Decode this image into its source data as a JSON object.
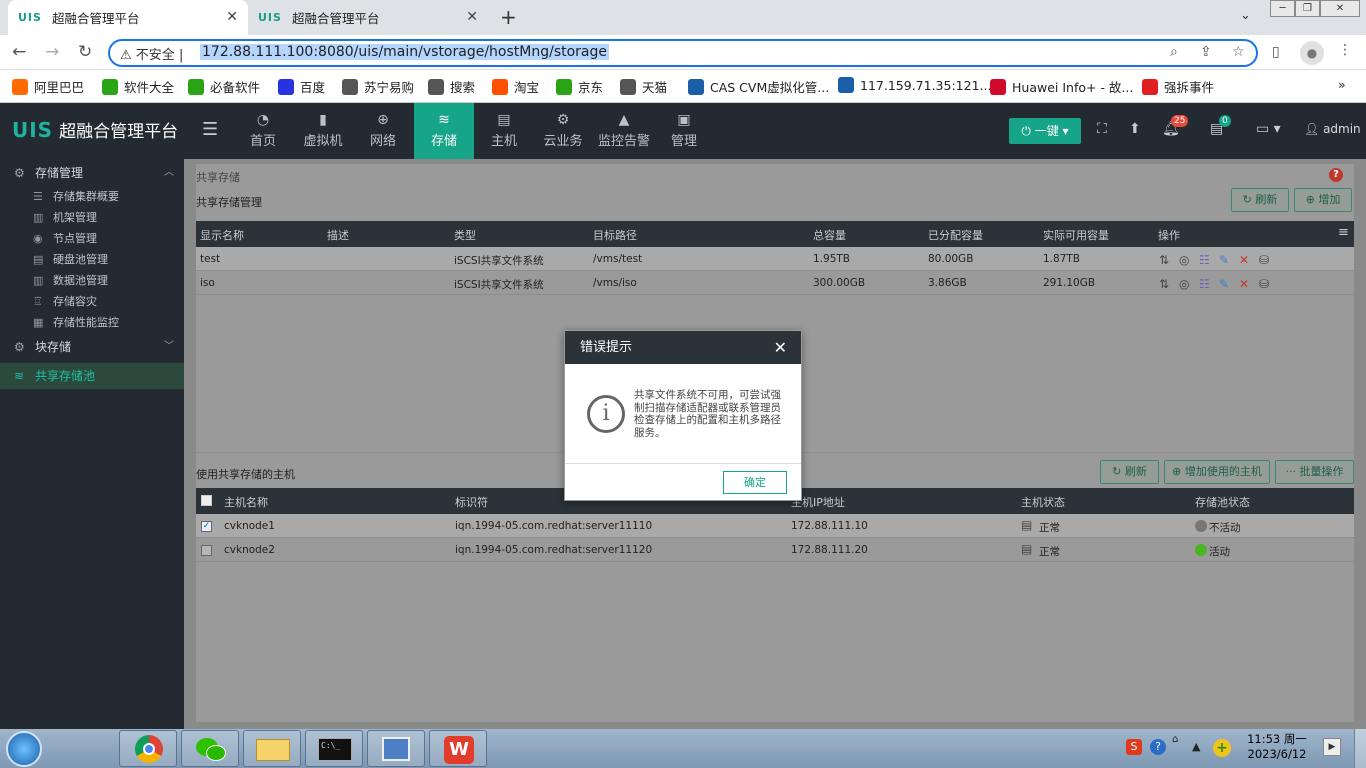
{
  "browser": {
    "tabs": [
      {
        "favicon": "UIS",
        "title": "超融合管理平台"
      },
      {
        "favicon": "UIS",
        "title": "超融合管理平台"
      }
    ],
    "security_label": "不安全",
    "url": "172.88.111.100:8080/uis/main/vstorage/hostMng/storage",
    "bookmarks": [
      {
        "label": "阿里巴巴",
        "color": "#ff6a00"
      },
      {
        "label": "软件大全",
        "color": "#2aa515"
      },
      {
        "label": "必备软件",
        "color": "#2aa515"
      },
      {
        "label": "百度",
        "color": "#2932e1"
      },
      {
        "label": "苏宁易购",
        "color": "#555555"
      },
      {
        "label": "搜索",
        "color": "#555555"
      },
      {
        "label": "淘宝",
        "color": "#ff5000"
      },
      {
        "label": "京东",
        "color": "#2aa515"
      },
      {
        "label": "天猫",
        "color": "#555555"
      },
      {
        "label": "CAS CVM虚拟化管...",
        "color": "#1a5fa8"
      },
      {
        "label": "117.159.71.35:121...",
        "color": "#1a5fa8"
      },
      {
        "label": "Huawei Info+ - 故...",
        "color": "#cf0a2c"
      },
      {
        "label": "强拆事件",
        "color": "#e02020"
      }
    ]
  },
  "app": {
    "logo_mark": "UIS",
    "logo_text": "超融合管理平台",
    "nav": [
      {
        "label": "首页",
        "icon": "dashboard-icon"
      },
      {
        "label": "虚拟机",
        "icon": "vm-icon"
      },
      {
        "label": "网络",
        "icon": "globe-icon"
      },
      {
        "label": "存储",
        "icon": "database-icon",
        "active": true
      },
      {
        "label": "主机",
        "icon": "server-icon"
      },
      {
        "label": "云业务",
        "icon": "gear-icon"
      },
      {
        "label": "监控告警",
        "icon": "bell-icon"
      },
      {
        "label": "管理",
        "icon": "monitor-icon"
      }
    ],
    "onekey_label": "一键",
    "alarm_count": "25",
    "task_count": "0",
    "user": "admin"
  },
  "sidebar": {
    "storage_mgmt": "存储管理",
    "items": [
      "存储集群概要",
      "机架管理",
      "节点管理",
      "硬盘池管理",
      "数据池管理",
      "存储容灾",
      "存储性能监控"
    ],
    "block_storage": "块存储",
    "shared_pool": "共享存储池"
  },
  "main": {
    "breadcrumb": "共享存储",
    "section_title": "共享存储管理",
    "refresh_label": "刷新",
    "add_label": "增加",
    "storage_table": {
      "headers": [
        "显示名称",
        "描述",
        "类型",
        "目标路径",
        "总容量",
        "已分配容量",
        "实际可用容量",
        "操作"
      ],
      "rows": [
        {
          "name": "test",
          "desc": "",
          "type": "iSCSI共享文件系统",
          "path": "/vms/test",
          "total": "1.95TB",
          "allocated": "80.00GB",
          "available": "1.87TB"
        },
        {
          "name": "iso",
          "desc": "",
          "type": "iSCSI共享文件系统",
          "path": "/vms/iso",
          "total": "300.00GB",
          "allocated": "3.86GB",
          "available": "291.10GB"
        }
      ]
    },
    "hosts_title": "使用共享存储的主机",
    "hosts_refresh": "刷新",
    "hosts_add": "增加使用的主机",
    "hosts_batch": "批量操作",
    "hosts_table": {
      "headers": [
        "主机名称",
        "标识符",
        "主机IP地址",
        "主机状态",
        "存储池状态"
      ],
      "rows": [
        {
          "checked": true,
          "name": "cvknode1",
          "iqn": "iqn.1994-05.com.redhat:server11110",
          "ip": "172.88.111.10",
          "host_status": "正常",
          "pool_status": "不活动",
          "pool_color": "#777777"
        },
        {
          "checked": false,
          "name": "cvknode2",
          "iqn": "iqn.1994-05.com.redhat:server11120",
          "ip": "172.88.111.20",
          "host_status": "正常",
          "pool_status": "活动",
          "pool_color": "#49b520"
        }
      ]
    }
  },
  "modal": {
    "title": "错误提示",
    "message": "共享文件系统不可用，可尝试强制扫描存储适配器或联系管理员检查存储上的配置和主机多路径服务。",
    "ok_label": "确定"
  },
  "taskbar": {
    "time": "11:53 周一",
    "date": "2023/6/12"
  }
}
